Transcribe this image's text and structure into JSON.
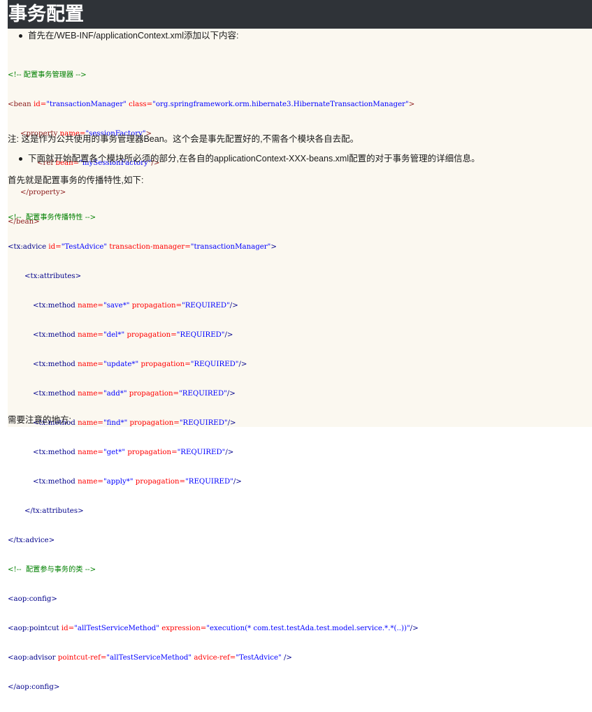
{
  "header": {
    "title": "事务配置"
  },
  "para1": {
    "bullet_text": "首先在/WEB-INF/applicationContext.xml添加以下内容:"
  },
  "code1": {
    "comment": "<!-- 配置事务管理器 -->",
    "bean_open_tag": "<bean",
    "bean_id_attr": "id=",
    "bean_id_val": "\"transactionManager\"",
    "bean_class_attr": "class=",
    "bean_class_val": "\"org.springframework.orm.hibernate3.HibernateTransactionManager\"",
    "bean_close": ">",
    "prop_tag": "<property",
    "prop_name_attr": "name=",
    "prop_name_val": "\"sessionFactory\"",
    "prop_close": ">",
    "ref_tag": "<ref",
    "ref_bean_attr": "bean=",
    "ref_bean_val": "\"mySessionFactory\"",
    "ref_close": "/>",
    "prop_end": "</property>",
    "bean_end": "</bean>"
  },
  "note1": "注: 这是作为公共使用的事务管理器Bean。这个会是事先配置好的,不需各个模块各自去配。",
  "para2": {
    "bullet_text": "下面就开始配置各个模块所必须的部分,在各自的applicationContext-XXX-beans.xml配置的对于事务管理的详细信息。"
  },
  "note2": "首先就是配置事务的传播特性,如下:",
  "code2": {
    "comment1": "<!--  配置事务传播特性 -->",
    "advice_tag": "<tx:advice",
    "advice_id_attr": "id=",
    "advice_id_val": "\"TestAdvice\"",
    "advice_tm_attr": "transaction-manager=",
    "advice_tm_val": "\"transactionManager\"",
    "advice_close": ">",
    "attributes_open": "<tx:attributes>",
    "methods": [
      {
        "tag": "<tx:method",
        "name_attr": "name=",
        "name_val": "\"save*\"",
        "prop_attr": "propagation=",
        "prop_val": "\"REQUIRED\"",
        "close": "/>"
      },
      {
        "tag": "<tx:method",
        "name_attr": "name=",
        "name_val": "\"del*\"",
        "prop_attr": "propagation=",
        "prop_val": "\"REQUIRED\"",
        "close": "/>"
      },
      {
        "tag": "<tx:method",
        "name_attr": "name=",
        "name_val": "\"update*\"",
        "prop_attr": "propagation=",
        "prop_val": "\"REQUIRED\"",
        "close": "/>"
      },
      {
        "tag": "<tx:method",
        "name_attr": "name=",
        "name_val": "\"add*\"",
        "prop_attr": "propagation=",
        "prop_val": "\"REQUIRED\"",
        "close": "/>"
      },
      {
        "tag": "<tx:method",
        "name_attr": "name=",
        "name_val": "\"find*\"",
        "prop_attr": "propagation=",
        "prop_val": "\"REQUIRED\"",
        "close": "/>"
      },
      {
        "tag": "<tx:method",
        "name_attr": "name=",
        "name_val": "\"get*\"",
        "prop_attr": "propagation=",
        "prop_val": "\"REQUIRED\"",
        "close": "/>"
      },
      {
        "tag": "<tx:method",
        "name_attr": "name=",
        "name_val": "\"apply*\"",
        "prop_attr": "propagation=",
        "prop_val": "\"REQUIRED\"",
        "close": "/>"
      }
    ],
    "attributes_close": "</tx:attributes>",
    "advice_end": "</tx:advice>",
    "comment2": "<!--  配置参与事务的类 -->",
    "config_open": "<aop:config>",
    "pointcut_tag": "<aop:pointcut",
    "pointcut_id_attr": "id=",
    "pointcut_id_val": "\"allTestServiceMethod\"",
    "pointcut_expr_attr": "expression=",
    "pointcut_expr_val": "\"execution(* com.test.testAda.test.model.service.*.*(..))\"",
    "pointcut_close": "/>",
    "advisor_tag": "<aop:advisor",
    "advisor_ref_attr": "pointcut-ref=",
    "advisor_ref_val": "\"allTestServiceMethod\"",
    "advisor_adv_attr": "advice-ref=",
    "advisor_adv_val": "\"TestAdvice\"",
    "advisor_close": "/>",
    "config_close": "</aop:config>"
  },
  "note3": "需要注意的地方:"
}
